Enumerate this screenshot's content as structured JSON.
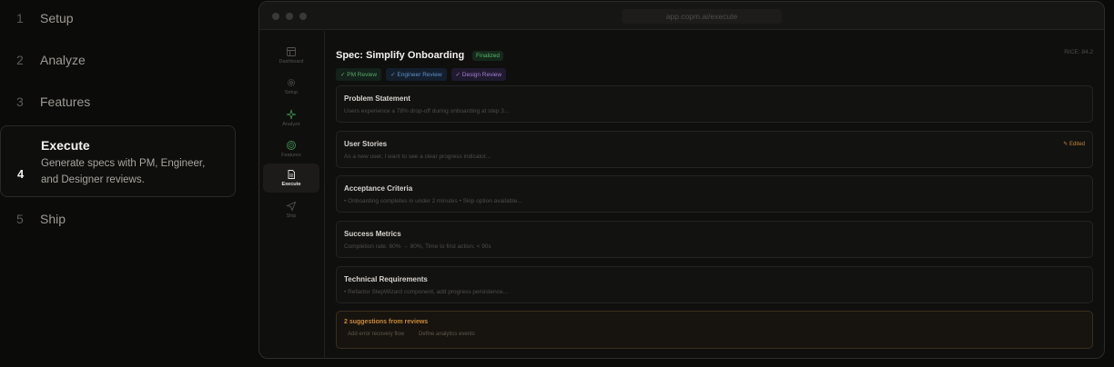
{
  "steps": [
    {
      "num": "1",
      "label": "Setup"
    },
    {
      "num": "2",
      "label": "Analyze"
    },
    {
      "num": "3",
      "label": "Features"
    },
    {
      "num": "4",
      "label": "Execute",
      "desc": "Generate specs with PM, Engineer, and Designer reviews."
    },
    {
      "num": "5",
      "label": "Ship"
    }
  ],
  "window": {
    "url": "app.copm.ai/execute"
  },
  "sidebar": {
    "items": [
      {
        "label": "Dashboard",
        "icon": "layout-icon"
      },
      {
        "label": "Setup",
        "icon": "gear-icon"
      },
      {
        "label": "Analyze",
        "icon": "sparkle-icon"
      },
      {
        "label": "Features",
        "icon": "target-icon"
      },
      {
        "label": "Execute",
        "icon": "document-icon"
      },
      {
        "label": "Ship",
        "icon": "send-icon"
      }
    ]
  },
  "spec": {
    "title": "Spec: Simplify Onboarding",
    "status": "Finalized",
    "rice": "RICE: 84.2",
    "reviews": [
      "✓ PM Review",
      "✓ Engineer Review",
      "✓ Design Review"
    ],
    "sections": [
      {
        "title": "Problem Statement",
        "desc": "Users experience a 78% drop-off during onboarding at step 3..."
      },
      {
        "title": "User Stories",
        "desc": "As a new user, I want to see a clear progress indicator...",
        "edited": "Edited"
      },
      {
        "title": "Acceptance Criteria",
        "desc": "• Onboarding completes in under 2 minutes • Skip option available..."
      },
      {
        "title": "Success Metrics",
        "desc": "Completion rate: 60% → 80%, Time to first action: < 90s"
      },
      {
        "title": "Technical Requirements",
        "desc": "• Refactor StepWizard component, add progress persistence..."
      }
    ],
    "suggestions": {
      "title": "2 suggestions from reviews",
      "items": [
        "Add error recovery flow",
        "Define analytics events"
      ]
    }
  },
  "colors": {
    "accent_green": "#59b36d",
    "accent_blue": "#5d8fc9",
    "accent_purple": "#a47fd4",
    "accent_orange": "#c98a3a"
  }
}
